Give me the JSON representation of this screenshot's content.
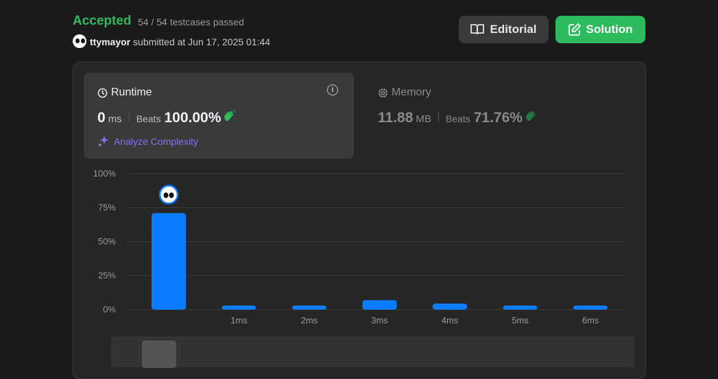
{
  "header": {
    "status": "Accepted",
    "testcases": "54 / 54 testcases passed",
    "username": "ttymayor",
    "submitted": "submitted at Jun 17, 2025 01:44",
    "editorial_label": "Editorial",
    "solution_label": "Solution"
  },
  "runtime": {
    "title": "Runtime",
    "value": "0",
    "unit": "ms",
    "beats_label": "Beats",
    "beats_value": "100.00%",
    "analyze_label": "Analyze Complexity"
  },
  "memory": {
    "title": "Memory",
    "value": "11.88",
    "unit": "MB",
    "beats_label": "Beats",
    "beats_value": "71.76%"
  },
  "colors": {
    "accepted": "#2cbb5d",
    "bar": "#0a7cff",
    "analyze": "#8b6ff0",
    "beats_icon": "#2cbb5d"
  },
  "icons": {
    "editorial": "book-open-icon",
    "solution": "edit-icon",
    "runtime": "clock-icon",
    "memory": "chip-icon",
    "info": "info-icon",
    "analyze": "sparkle-icon",
    "beats": "clapping-hands-icon"
  },
  "chart_data": {
    "type": "bar",
    "categories": [
      "",
      "1ms",
      "2ms",
      "3ms",
      "4ms",
      "5ms",
      "6ms"
    ],
    "values": [
      71,
      3,
      3,
      7,
      4.5,
      3,
      3
    ],
    "ylim": [
      0,
      100
    ],
    "yticks": [
      0,
      25,
      50,
      75,
      100
    ],
    "ytick_labels": [
      "0%",
      "25%",
      "50%",
      "75%",
      "100%"
    ],
    "grid": true,
    "highlighted_index": 0
  }
}
